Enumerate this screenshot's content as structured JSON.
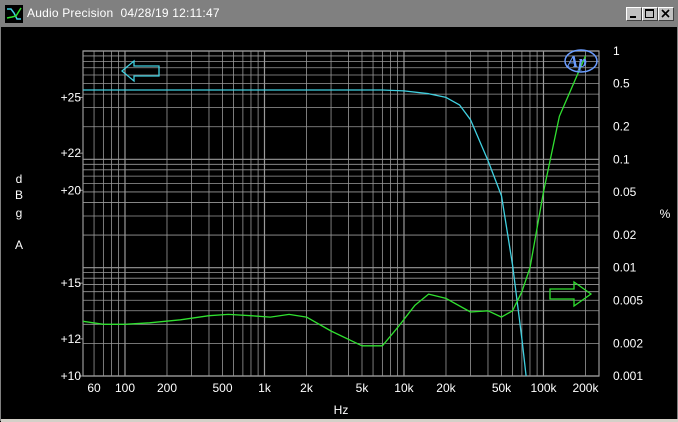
{
  "window": {
    "title": "Audio Precision  04/28/19 12:11:47",
    "buttons": [
      "minimize",
      "maximize",
      "close"
    ]
  },
  "colors": {
    "background": "#000000",
    "grid": "#9a9a9a",
    "trace_level": "#40d0e0",
    "trace_distortion": "#30e030",
    "text": "#ffffff",
    "titlebar": "#808080"
  },
  "logo": "Ap",
  "chart_data": {
    "type": "line",
    "x_scale": "log",
    "xlim": [
      50,
      250000
    ],
    "xlabel": "Hz",
    "x_ticks": [
      {
        "v": 60,
        "label": "60"
      },
      {
        "v": 100,
        "label": "100"
      },
      {
        "v": 200,
        "label": "200"
      },
      {
        "v": 500,
        "label": "500"
      },
      {
        "v": 1000,
        "label": "1k"
      },
      {
        "v": 2000,
        "label": "2k"
      },
      {
        "v": 5000,
        "label": "5k"
      },
      {
        "v": 10000,
        "label": "10k"
      },
      {
        "v": 20000,
        "label": "20k"
      },
      {
        "v": 50000,
        "label": "50k"
      },
      {
        "v": 100000,
        "label": "100k"
      },
      {
        "v": 200000,
        "label": "200k"
      }
    ],
    "y_left": {
      "label_chars": [
        "d",
        "B",
        "g",
        "",
        "A"
      ],
      "ylim": [
        10,
        27.5
      ],
      "ticks": [
        {
          "v": 10,
          "label": "+10"
        },
        {
          "v": 12,
          "label": "+12"
        },
        {
          "v": 15,
          "label": "+15"
        },
        {
          "v": 20,
          "label": "+20"
        },
        {
          "v": 22,
          "label": "+22"
        },
        {
          "v": 25,
          "label": "+25"
        }
      ]
    },
    "y_right": {
      "label": "%",
      "scale": "log",
      "ylim": [
        0.001,
        1
      ],
      "ticks": [
        {
          "v": 1,
          "label": "1"
        },
        {
          "v": 0.5,
          "label": "0.5"
        },
        {
          "v": 0.2,
          "label": "0.2"
        },
        {
          "v": 0.1,
          "label": "0.1"
        },
        {
          "v": 0.05,
          "label": "0.05"
        },
        {
          "v": 0.02,
          "label": "0.02"
        },
        {
          "v": 0.01,
          "label": "0.01"
        },
        {
          "v": 0.005,
          "label": "0.005"
        },
        {
          "v": 0.002,
          "label": "0.002"
        },
        {
          "v": 0.001,
          "label": "0.001"
        }
      ]
    },
    "series": [
      {
        "axis": "left",
        "color": "#40d0e0",
        "points": [
          [
            50,
            25.4
          ],
          [
            100,
            25.4
          ],
          [
            500,
            25.4
          ],
          [
            1000,
            25.4
          ],
          [
            2000,
            25.4
          ],
          [
            5000,
            25.4
          ],
          [
            7000,
            25.4
          ],
          [
            10000,
            25.35
          ],
          [
            15000,
            25.2
          ],
          [
            20000,
            25.0
          ],
          [
            25000,
            24.6
          ],
          [
            30000,
            23.8
          ],
          [
            40000,
            21.6
          ],
          [
            50000,
            19.7
          ],
          [
            60000,
            16.0
          ],
          [
            70000,
            12.0
          ],
          [
            75000,
            10.0
          ]
        ]
      },
      {
        "axis": "right",
        "color": "#30e030",
        "points": [
          [
            50,
            0.0032
          ],
          [
            70,
            0.003
          ],
          [
            100,
            0.003
          ],
          [
            150,
            0.0031
          ],
          [
            250,
            0.0033
          ],
          [
            400,
            0.0036
          ],
          [
            550,
            0.0037
          ],
          [
            800,
            0.0036
          ],
          [
            1100,
            0.0035
          ],
          [
            1500,
            0.0037
          ],
          [
            2000,
            0.0035
          ],
          [
            3000,
            0.0026
          ],
          [
            5000,
            0.0019
          ],
          [
            7000,
            0.0019
          ],
          [
            9000,
            0.0028
          ],
          [
            12000,
            0.0045
          ],
          [
            15000,
            0.0057
          ],
          [
            20000,
            0.0052
          ],
          [
            30000,
            0.0039
          ],
          [
            40000,
            0.004
          ],
          [
            50000,
            0.0035
          ],
          [
            60000,
            0.004
          ],
          [
            70000,
            0.006
          ],
          [
            80000,
            0.01
          ],
          [
            100000,
            0.05
          ],
          [
            130000,
            0.25
          ],
          [
            200000,
            0.9
          ]
        ]
      }
    ],
    "annotations": [
      {
        "type": "arrow",
        "direction": "left",
        "points_to": "left-axis",
        "color": "#40d0e0"
      },
      {
        "type": "arrow",
        "direction": "right",
        "points_to": "right-axis",
        "color": "#30e030"
      }
    ]
  }
}
